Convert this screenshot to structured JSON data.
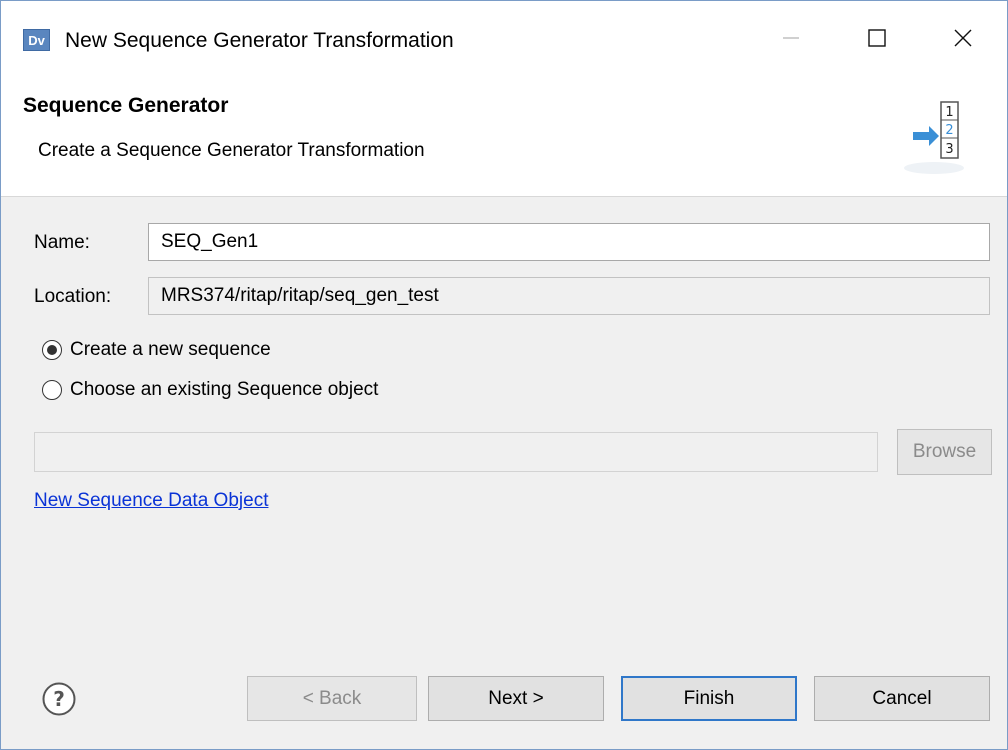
{
  "window": {
    "title": "New Sequence Generator Transformation",
    "app_icon_text": "Dv"
  },
  "banner": {
    "title": "Sequence Generator",
    "subtitle": "Create a Sequence Generator Transformation",
    "icon": "sequence-generator-icon",
    "icon_digits": [
      "1",
      "2",
      "3"
    ]
  },
  "form": {
    "name_label": "Name:",
    "name_value": "SEQ_Gen1",
    "location_label": "Location:",
    "location_value": "MRS374/ritap/ritap/seq_gen_test"
  },
  "options": {
    "create_new_label": "Create a new sequence",
    "choose_existing_label": "Choose an existing Sequence object",
    "selected": "create_new"
  },
  "sequence_object": {
    "value": "",
    "browse_label": "Browse"
  },
  "link": {
    "new_sequence_label": "New Sequence Data Object"
  },
  "footer": {
    "help_icon": "help-icon",
    "back_label": "< Back",
    "next_label": "Next >",
    "finish_label": "Finish",
    "cancel_label": "Cancel"
  },
  "colors": {
    "accent": "#2f77c9",
    "link": "#0a33d6",
    "icon_blue": "#3a8fd6"
  }
}
